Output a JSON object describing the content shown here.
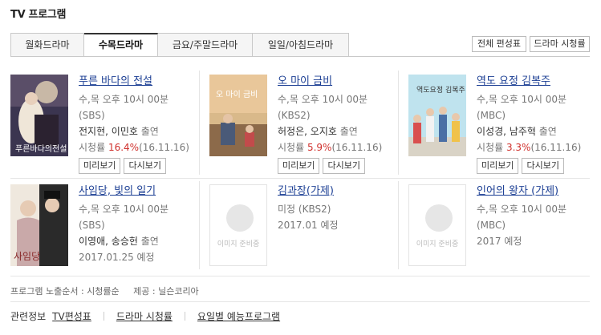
{
  "header": {
    "title": "TV 프로그램"
  },
  "tabs": [
    {
      "label": "월화드라마"
    },
    {
      "label": "수목드라마"
    },
    {
      "label": "금요/주말드라마"
    },
    {
      "label": "일일/아침드라마"
    }
  ],
  "toolbar": {
    "schedule_label": "전체 편성표",
    "ratings_label": "드라마 시청률"
  },
  "common": {
    "preview": "미리보기",
    "replay": "다시보기",
    "no_image": "이미지 준비중",
    "appear": "출연",
    "comma": ",",
    "ratings_prefix": "시청률"
  },
  "programs": [
    {
      "title": "푸른 바다의 전설",
      "time": "수,목 오후 10시 00분",
      "channel": "(SBS)",
      "cast1": "전지현",
      "cast2": "이민호",
      "rating": "16.4%",
      "rating_date": "(16.11.16)"
    },
    {
      "title": "오 마이 금비",
      "time": "수,목 오후 10시 00분",
      "channel": "(KBS2)",
      "cast1": "허정은",
      "cast2": "오지호",
      "rating": "5.9%",
      "rating_date": "(16.11.16)"
    },
    {
      "title": "역도 요정 김복주",
      "time": "수,목 오후 10시 00분",
      "channel": "(MBC)",
      "cast1": "이성경",
      "cast2": "남주혁",
      "rating": "3.3%",
      "rating_date": "(16.11.16)"
    },
    {
      "title": "사임당, 빛의 일기",
      "time": "수,목 오후 10시 00분",
      "channel": "(SBS)",
      "cast1": "이영애",
      "cast2": "송승헌",
      "date": "2017.01.25 예정"
    },
    {
      "title": "김과장(가제)",
      "channel": "미정 (KBS2)",
      "date": "2017.01 예정"
    },
    {
      "title": "인어의 왕자 (가제)",
      "time": "수,목 오후 10시 00분",
      "channel": "(MBC)",
      "date": "2017 예정"
    }
  ],
  "footer": {
    "order_label": "프로그램 노출순서 : 시청률순",
    "provider_label": "제공 : 닐슨코리아"
  },
  "related": {
    "label": "관련정보",
    "links": [
      "TV편성표",
      "드라마 시청률",
      "요일별 예능프로그램"
    ]
  }
}
